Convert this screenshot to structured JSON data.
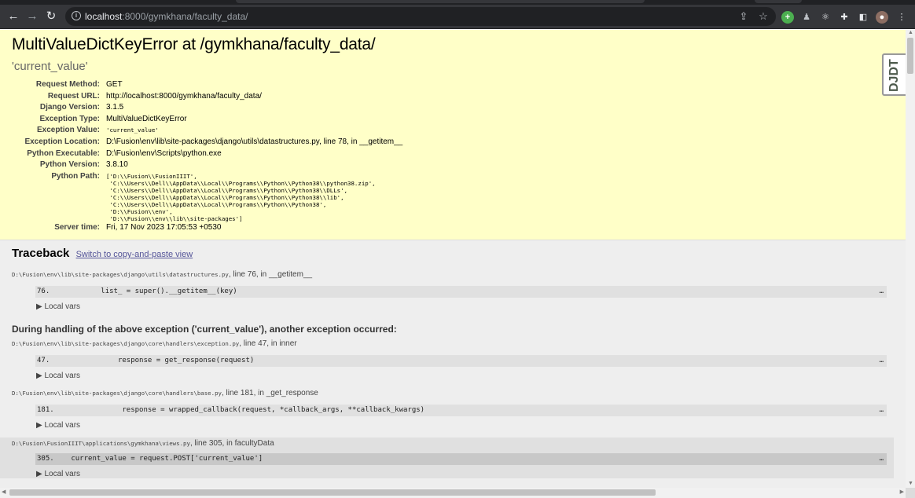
{
  "browser": {
    "url_host": "localhost",
    "url_rest": ":8000/gymkhana/faculty_data/",
    "icons": [
      "back-icon",
      "forward-icon",
      "reload-icon",
      "info-icon",
      "share-icon",
      "star-icon",
      "extension-green-icon",
      "extension-icon",
      "react-icon",
      "puzzle-icon",
      "sidepanel-icon",
      "profile-avatar",
      "menu-icon"
    ]
  },
  "summary": {
    "title": "MultiValueDictKeyError at /gymkhana/faculty_data/",
    "subtitle": "'current_value'",
    "rows": [
      {
        "k": "Request Method:",
        "v": "GET"
      },
      {
        "k": "Request URL:",
        "v": "http://localhost:8000/gymkhana/faculty_data/"
      },
      {
        "k": "Django Version:",
        "v": "3.1.5"
      },
      {
        "k": "Exception Type:",
        "v": "MultiValueDictKeyError"
      },
      {
        "k": "Exception Value:",
        "v": "'current_value'"
      },
      {
        "k": "Exception Location:",
        "v": "D:\\Fusion\\env\\lib\\site-packages\\django\\utils\\datastructures.py, line 78, in __getitem__"
      },
      {
        "k": "Python Executable:",
        "v": "D:\\Fusion\\env\\Scripts\\python.exe"
      },
      {
        "k": "Python Version:",
        "v": "3.8.10"
      }
    ],
    "python_path_label": "Python Path:",
    "python_path": "['D:\\\\Fusion\\\\FusionIIIT',\n 'C:\\\\Users\\\\Dell\\\\AppData\\\\Local\\\\Programs\\\\Python\\\\Python38\\\\python38.zip',\n 'C:\\\\Users\\\\Dell\\\\AppData\\\\Local\\\\Programs\\\\Python\\\\Python38\\\\DLLs',\n 'C:\\\\Users\\\\Dell\\\\AppData\\\\Local\\\\Programs\\\\Python\\\\Python38\\\\lib',\n 'C:\\\\Users\\\\Dell\\\\AppData\\\\Local\\\\Programs\\\\Python\\\\Python38',\n 'D:\\\\Fusion\\\\env',\n 'D:\\\\Fusion\\\\env\\\\lib\\\\site-packages']",
    "server_time_label": "Server time:",
    "server_time": "Fri, 17 Nov 2023 17:05:53 +0530"
  },
  "djdt_label": "DJDT",
  "traceback": {
    "heading": "Traceback",
    "switch_link": "Switch to copy-and-paste view",
    "during_heading": "During handling of the above exception ('current_value'), another exception occurred:",
    "local_vars": "▶ Local vars",
    "ellipsis": "…",
    "frames": [
      {
        "file": "D:\\Fusion\\env\\lib\\site-packages\\django\\utils\\datastructures.py",
        "where": ", line 76, in __getitem__",
        "code": "76.            list_ = super().__getitem__(key)"
      },
      {
        "file": "D:\\Fusion\\env\\lib\\site-packages\\django\\core\\handlers\\exception.py",
        "where": ", line 47, in inner",
        "code": "47.                response = get_response(request)"
      },
      {
        "file": "D:\\Fusion\\env\\lib\\site-packages\\django\\core\\handlers\\base.py",
        "where": ", line 181, in _get_response",
        "code": "181.                response = wrapped_callback(request, *callback_args, **callback_kwargs)"
      },
      {
        "file": "D:\\Fusion\\FusionIIIT\\applications\\gymkhana\\views.py",
        "where": ", line 305, in facultyData",
        "code": "305.    current_value = request.POST['current_value']"
      }
    ]
  }
}
